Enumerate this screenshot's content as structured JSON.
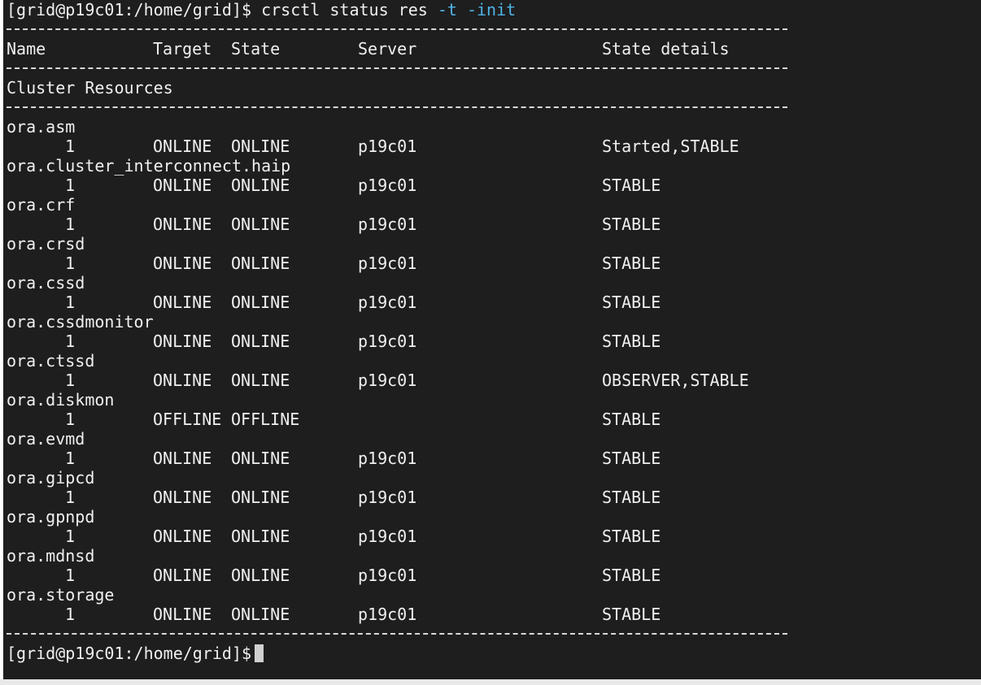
{
  "terminal": {
    "command_prompt": "[grid@p19c01:/home/grid]$ ",
    "command": "crsctl status res ",
    "command_flags": "-t -init",
    "final_prompt": "[grid@p19c01:/home/grid]$"
  },
  "headers": {
    "name": "Name",
    "target": "Target",
    "state": "State",
    "server": "Server",
    "details": "State details"
  },
  "section_title": "Cluster Resources",
  "resources": [
    {
      "name": "ora.asm",
      "instance": "1",
      "target": "ONLINE",
      "state": "ONLINE",
      "server": "p19c01",
      "details": "Started,STABLE"
    },
    {
      "name": "ora.cluster_interconnect.haip",
      "instance": "1",
      "target": "ONLINE",
      "state": "ONLINE",
      "server": "p19c01",
      "details": "STABLE"
    },
    {
      "name": "ora.crf",
      "instance": "1",
      "target": "ONLINE",
      "state": "ONLINE",
      "server": "p19c01",
      "details": "STABLE"
    },
    {
      "name": "ora.crsd",
      "instance": "1",
      "target": "ONLINE",
      "state": "ONLINE",
      "server": "p19c01",
      "details": "STABLE"
    },
    {
      "name": "ora.cssd",
      "instance": "1",
      "target": "ONLINE",
      "state": "ONLINE",
      "server": "p19c01",
      "details": "STABLE"
    },
    {
      "name": "ora.cssdmonitor",
      "instance": "1",
      "target": "ONLINE",
      "state": "ONLINE",
      "server": "p19c01",
      "details": "STABLE"
    },
    {
      "name": "ora.ctssd",
      "instance": "1",
      "target": "ONLINE",
      "state": "ONLINE",
      "server": "p19c01",
      "details": "OBSERVER,STABLE"
    },
    {
      "name": "ora.diskmon",
      "instance": "1",
      "target": "OFFLINE",
      "state": "OFFLINE",
      "server": "",
      "details": "STABLE"
    },
    {
      "name": "ora.evmd",
      "instance": "1",
      "target": "ONLINE",
      "state": "ONLINE",
      "server": "p19c01",
      "details": "STABLE"
    },
    {
      "name": "ora.gipcd",
      "instance": "1",
      "target": "ONLINE",
      "state": "ONLINE",
      "server": "p19c01",
      "details": "STABLE"
    },
    {
      "name": "ora.gpnpd",
      "instance": "1",
      "target": "ONLINE",
      "state": "ONLINE",
      "server": "p19c01",
      "details": "STABLE"
    },
    {
      "name": "ora.mdnsd",
      "instance": "1",
      "target": "ONLINE",
      "state": "ONLINE",
      "server": "p19c01",
      "details": "STABLE"
    },
    {
      "name": "ora.storage",
      "instance": "1",
      "target": "ONLINE",
      "state": "ONLINE",
      "server": "p19c01",
      "details": "STABLE"
    }
  ],
  "colors": {
    "background": "#1e1e1e",
    "text": "#f0f0f0",
    "flag": "#4fb3e8"
  }
}
